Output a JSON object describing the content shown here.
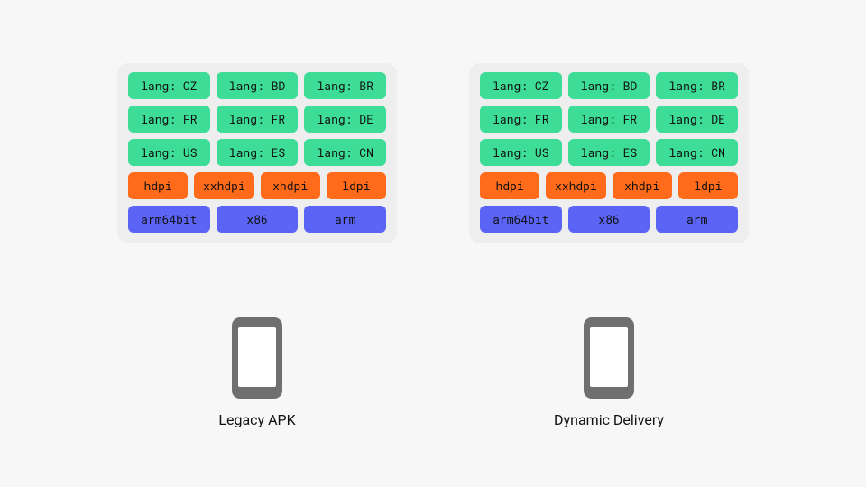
{
  "colors": {
    "lang": "#3ddc97",
    "dpi": "#ff6b1a",
    "abi": "#5b64f5",
    "panel": "#eeeeee",
    "bg": "#f7f7f7",
    "phone": "#6f6f6f"
  },
  "bundle": {
    "lang_rows": [
      [
        "lang: CZ",
        "lang: BD",
        "lang: BR"
      ],
      [
        "lang: FR",
        "lang: FR",
        "lang: DE"
      ],
      [
        "lang: US",
        "lang: ES",
        "lang: CN"
      ]
    ],
    "dpi_row": [
      "hdpi",
      "xxhdpi",
      "xhdpi",
      "ldpi"
    ],
    "abi_row": [
      "arm64bit",
      "x86",
      "arm"
    ]
  },
  "left": {
    "caption": "Legacy APK"
  },
  "right": {
    "caption": "Dynamic Delivery"
  }
}
